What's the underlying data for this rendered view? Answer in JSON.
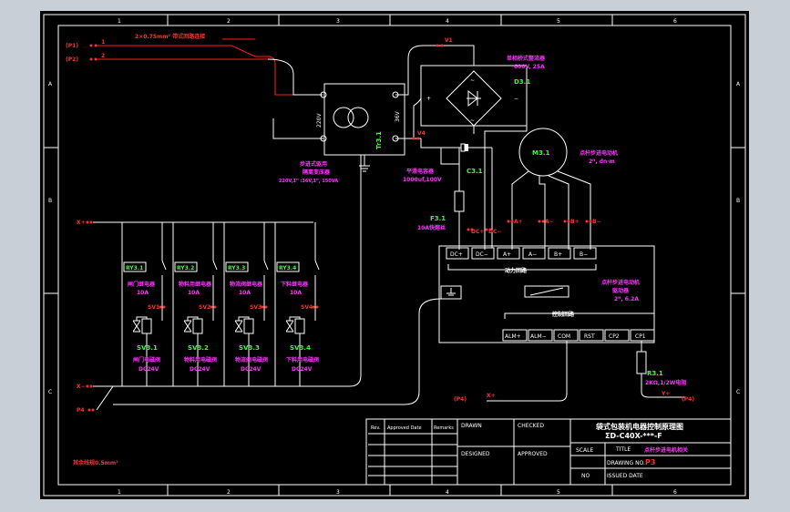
{
  "zone_cols": [
    "1",
    "2",
    "3",
    "4",
    "5",
    "6"
  ],
  "zone_rows": [
    "A",
    "B",
    "C"
  ],
  "left_inputs": {
    "p1": "(P1)",
    "p2": "(P2)",
    "n1": "1",
    "n2": "2"
  },
  "cable_note": "2×0.75mm² 带式回路连接",
  "bridge": {
    "name": "单相桥式整流器",
    "spec": "600V, 25A",
    "id": "D3.1"
  },
  "transformer": {
    "name": "步进式驱用",
    "name2": "隔离变压器",
    "spec": "220V,1ᴴ :36V,1ᴴ, 150VA",
    "primary": "220V",
    "secondary": "36V",
    "id": "Tr3.1"
  },
  "capacitor": {
    "name": "平滑电容器",
    "spec": "1000uf,100V",
    "id": "C3.1"
  },
  "fuse": {
    "id": "F3.1",
    "spec": "10A快熔丝"
  },
  "motor": {
    "id": "M3.1",
    "name": "点杆步进电动机",
    "spec": "2ᴴ, dn·m"
  },
  "motor_pins": [
    "A+",
    "A−",
    "B+",
    "B−"
  ],
  "driver": {
    "power_terms": [
      "DC+",
      "DC−",
      "A+",
      "A−",
      "B+",
      "B−"
    ],
    "power_label": "动力回路",
    "note1": "点杆步进电动机",
    "note2": "驱动器",
    "note3": "2ᴴ, 6.2A",
    "ctrl_label": "控制回路",
    "ctrl_terms": [
      "ALM+",
      "ALM−",
      "COM",
      "RST",
      "CP2",
      "CP1"
    ]
  },
  "resistor": {
    "id": "R3.1",
    "spec": "2KΩ,1/2W电阻"
  },
  "wire_labels": {
    "v1": "V1",
    "v4": "V4",
    "v2": "V2",
    "xa": "X+",
    "xb": "X−",
    "x1": "X1",
    "pa": "(P4)",
    "pb": "(P4)",
    "dc_plus": "DC+",
    "dc_minus": "DC−",
    "x_plus": "X+",
    "y_plus": "Y+",
    "p4": "P4"
  },
  "relays": [
    {
      "tag": "RY3.1",
      "name": "闸门继电器",
      "rating": "10A",
      "sv_terminal": "SV1",
      "sv": "SV3.1",
      "sv_name": "闸门电磁阀",
      "sv_rating": "DC24V"
    },
    {
      "tag": "RY3.2",
      "name": "物料用继电器",
      "rating": "10A",
      "sv_terminal": "SV2",
      "sv": "SV3.2",
      "sv_name": "物料用电磁阀",
      "sv_rating": "DC24V"
    },
    {
      "tag": "RY3.3",
      "name": "物流阀继电器",
      "rating": "10A",
      "sv_terminal": "SV3",
      "sv": "SV3.3",
      "sv_name": "物流阀电磁阀",
      "sv_rating": "DC24V"
    },
    {
      "tag": "RY3.4",
      "name": "下料继电器",
      "rating": "10A",
      "sv_terminal": "SV4",
      "sv": "SV3.4",
      "sv_name": "下料用电磁阀",
      "sv_rating": "DC24V"
    }
  ],
  "bottom_note": "其余线规0.5mm²",
  "title_block": {
    "rev": "Rev.",
    "approved_date": "Approved Date",
    "remarks": "Remarks",
    "drawn": "DRAWN",
    "checked": "CHECKED",
    "designed": "DESIGNED",
    "approved": "APPROVED",
    "scale": "SCALE",
    "title": "TITLE",
    "drawing_no": "DRAWING NO.",
    "no": "NO",
    "issued_date": "ISSUED DATE",
    "main_title": "袋式包装机电器控制原理图",
    "sub_title": "ΣD-C40X-***-F",
    "title_value": "点杆步进电机相关",
    "drawing_value": "P3"
  },
  "colors": {
    "bg": "#000000",
    "wire": "#ffffff",
    "red": "#ff3030",
    "magenta": "#ff33ff",
    "green": "#33ff33",
    "page": "#c9cfd6"
  }
}
